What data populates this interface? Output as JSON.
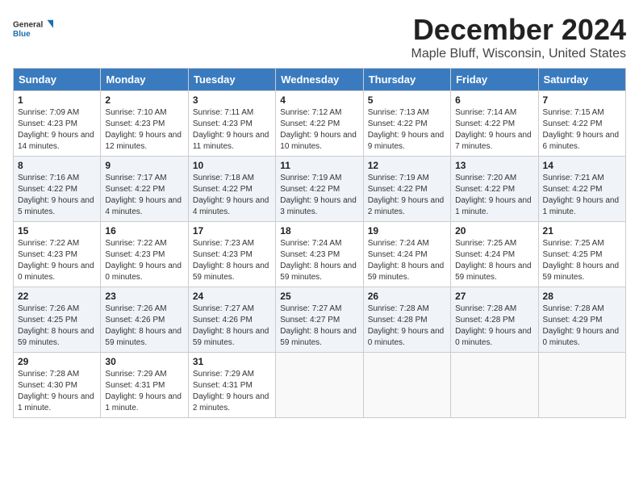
{
  "header": {
    "logo_line1": "General",
    "logo_line2": "Blue",
    "month_title": "December 2024",
    "subtitle": "Maple Bluff, Wisconsin, United States"
  },
  "weekdays": [
    "Sunday",
    "Monday",
    "Tuesday",
    "Wednesday",
    "Thursday",
    "Friday",
    "Saturday"
  ],
  "weeks": [
    [
      {
        "day": "1",
        "sunrise": "Sunrise: 7:09 AM",
        "sunset": "Sunset: 4:23 PM",
        "daylight": "Daylight: 9 hours and 14 minutes."
      },
      {
        "day": "2",
        "sunrise": "Sunrise: 7:10 AM",
        "sunset": "Sunset: 4:23 PM",
        "daylight": "Daylight: 9 hours and 12 minutes."
      },
      {
        "day": "3",
        "sunrise": "Sunrise: 7:11 AM",
        "sunset": "Sunset: 4:23 PM",
        "daylight": "Daylight: 9 hours and 11 minutes."
      },
      {
        "day": "4",
        "sunrise": "Sunrise: 7:12 AM",
        "sunset": "Sunset: 4:22 PM",
        "daylight": "Daylight: 9 hours and 10 minutes."
      },
      {
        "day": "5",
        "sunrise": "Sunrise: 7:13 AM",
        "sunset": "Sunset: 4:22 PM",
        "daylight": "Daylight: 9 hours and 9 minutes."
      },
      {
        "day": "6",
        "sunrise": "Sunrise: 7:14 AM",
        "sunset": "Sunset: 4:22 PM",
        "daylight": "Daylight: 9 hours and 7 minutes."
      },
      {
        "day": "7",
        "sunrise": "Sunrise: 7:15 AM",
        "sunset": "Sunset: 4:22 PM",
        "daylight": "Daylight: 9 hours and 6 minutes."
      }
    ],
    [
      {
        "day": "8",
        "sunrise": "Sunrise: 7:16 AM",
        "sunset": "Sunset: 4:22 PM",
        "daylight": "Daylight: 9 hours and 5 minutes."
      },
      {
        "day": "9",
        "sunrise": "Sunrise: 7:17 AM",
        "sunset": "Sunset: 4:22 PM",
        "daylight": "Daylight: 9 hours and 4 minutes."
      },
      {
        "day": "10",
        "sunrise": "Sunrise: 7:18 AM",
        "sunset": "Sunset: 4:22 PM",
        "daylight": "Daylight: 9 hours and 4 minutes."
      },
      {
        "day": "11",
        "sunrise": "Sunrise: 7:19 AM",
        "sunset": "Sunset: 4:22 PM",
        "daylight": "Daylight: 9 hours and 3 minutes."
      },
      {
        "day": "12",
        "sunrise": "Sunrise: 7:19 AM",
        "sunset": "Sunset: 4:22 PM",
        "daylight": "Daylight: 9 hours and 2 minutes."
      },
      {
        "day": "13",
        "sunrise": "Sunrise: 7:20 AM",
        "sunset": "Sunset: 4:22 PM",
        "daylight": "Daylight: 9 hours and 1 minute."
      },
      {
        "day": "14",
        "sunrise": "Sunrise: 7:21 AM",
        "sunset": "Sunset: 4:22 PM",
        "daylight": "Daylight: 9 hours and 1 minute."
      }
    ],
    [
      {
        "day": "15",
        "sunrise": "Sunrise: 7:22 AM",
        "sunset": "Sunset: 4:23 PM",
        "daylight": "Daylight: 9 hours and 0 minutes."
      },
      {
        "day": "16",
        "sunrise": "Sunrise: 7:22 AM",
        "sunset": "Sunset: 4:23 PM",
        "daylight": "Daylight: 9 hours and 0 minutes."
      },
      {
        "day": "17",
        "sunrise": "Sunrise: 7:23 AM",
        "sunset": "Sunset: 4:23 PM",
        "daylight": "Daylight: 8 hours and 59 minutes."
      },
      {
        "day": "18",
        "sunrise": "Sunrise: 7:24 AM",
        "sunset": "Sunset: 4:23 PM",
        "daylight": "Daylight: 8 hours and 59 minutes."
      },
      {
        "day": "19",
        "sunrise": "Sunrise: 7:24 AM",
        "sunset": "Sunset: 4:24 PM",
        "daylight": "Daylight: 8 hours and 59 minutes."
      },
      {
        "day": "20",
        "sunrise": "Sunrise: 7:25 AM",
        "sunset": "Sunset: 4:24 PM",
        "daylight": "Daylight: 8 hours and 59 minutes."
      },
      {
        "day": "21",
        "sunrise": "Sunrise: 7:25 AM",
        "sunset": "Sunset: 4:25 PM",
        "daylight": "Daylight: 8 hours and 59 minutes."
      }
    ],
    [
      {
        "day": "22",
        "sunrise": "Sunrise: 7:26 AM",
        "sunset": "Sunset: 4:25 PM",
        "daylight": "Daylight: 8 hours and 59 minutes."
      },
      {
        "day": "23",
        "sunrise": "Sunrise: 7:26 AM",
        "sunset": "Sunset: 4:26 PM",
        "daylight": "Daylight: 8 hours and 59 minutes."
      },
      {
        "day": "24",
        "sunrise": "Sunrise: 7:27 AM",
        "sunset": "Sunset: 4:26 PM",
        "daylight": "Daylight: 8 hours and 59 minutes."
      },
      {
        "day": "25",
        "sunrise": "Sunrise: 7:27 AM",
        "sunset": "Sunset: 4:27 PM",
        "daylight": "Daylight: 8 hours and 59 minutes."
      },
      {
        "day": "26",
        "sunrise": "Sunrise: 7:28 AM",
        "sunset": "Sunset: 4:28 PM",
        "daylight": "Daylight: 9 hours and 0 minutes."
      },
      {
        "day": "27",
        "sunrise": "Sunrise: 7:28 AM",
        "sunset": "Sunset: 4:28 PM",
        "daylight": "Daylight: 9 hours and 0 minutes."
      },
      {
        "day": "28",
        "sunrise": "Sunrise: 7:28 AM",
        "sunset": "Sunset: 4:29 PM",
        "daylight": "Daylight: 9 hours and 0 minutes."
      }
    ],
    [
      {
        "day": "29",
        "sunrise": "Sunrise: 7:28 AM",
        "sunset": "Sunset: 4:30 PM",
        "daylight": "Daylight: 9 hours and 1 minute."
      },
      {
        "day": "30",
        "sunrise": "Sunrise: 7:29 AM",
        "sunset": "Sunset: 4:31 PM",
        "daylight": "Daylight: 9 hours and 1 minute."
      },
      {
        "day": "31",
        "sunrise": "Sunrise: 7:29 AM",
        "sunset": "Sunset: 4:31 PM",
        "daylight": "Daylight: 9 hours and 2 minutes."
      },
      null,
      null,
      null,
      null
    ]
  ]
}
